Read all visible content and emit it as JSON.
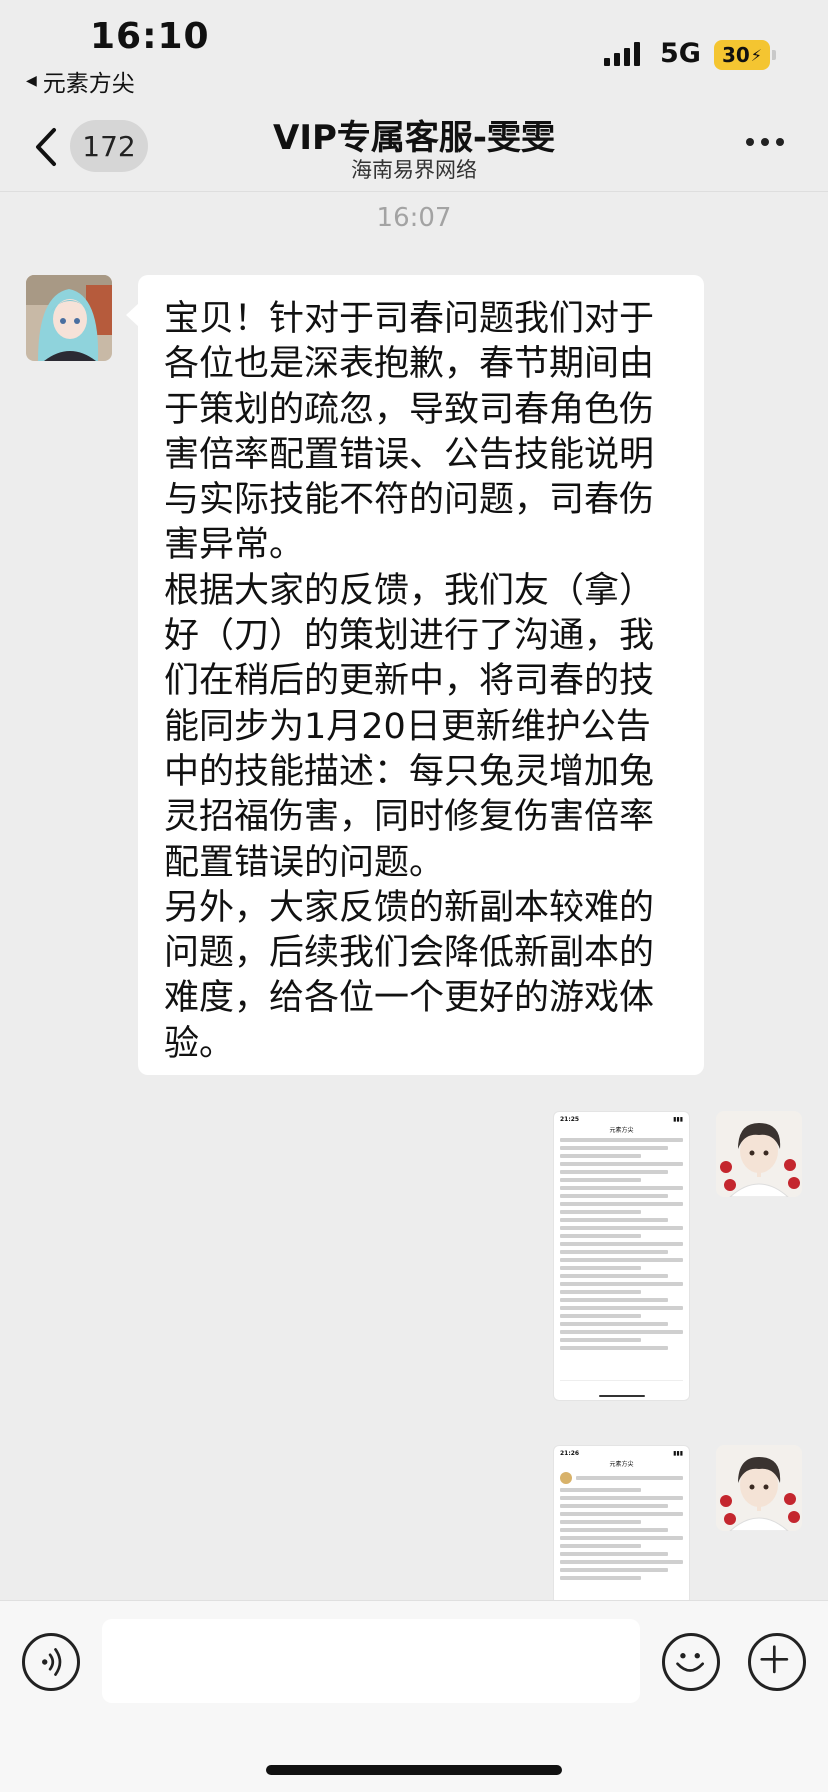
{
  "status_bar": {
    "time": "16:10",
    "back_app": "元素方尖",
    "network": "5G",
    "battery": "30"
  },
  "nav": {
    "unread_count": "172",
    "title": "VIP专属客服-雯雯",
    "subtitle": "海南易界网络"
  },
  "chat": {
    "timestamp": "16:07",
    "messages": [
      {
        "paragraphs": [
          "宝贝！针对于司春问题我们对于各位也是深表抱歉，春节期间由于策划的疏忽，导致司春角色伤害倍率配置错误、公告技能说明与实际技能不符的问题，司春伤害异常。",
          "根据大家的反馈，我们友（拿）好（刀）的策划进行了沟通，我们在稍后的更新中，将司春的技能同步为1月20日更新维护公告中的技能描述：每只兔灵增加兔灵招福伤害，同时修复伤害倍率配置错误的问题。",
          "另外，大家反馈的新副本较难的问题，后续我们会降低新副本的难度，给各位一个更好的游戏体验。"
        ]
      }
    ],
    "screenshots": [
      {
        "time": "21:25",
        "title": "元素方尖"
      },
      {
        "time": "21:26",
        "title": "元素方尖"
      }
    ]
  },
  "colors": {
    "chat_bg": "#ededed",
    "bubble_bg": "#ffffff",
    "battery": "#f4c531"
  },
  "icons": {
    "voice": "voice-icon",
    "emoji": "emoji-icon",
    "plus": "plus-icon",
    "back": "chevron-left-icon",
    "more": "more-icon"
  }
}
